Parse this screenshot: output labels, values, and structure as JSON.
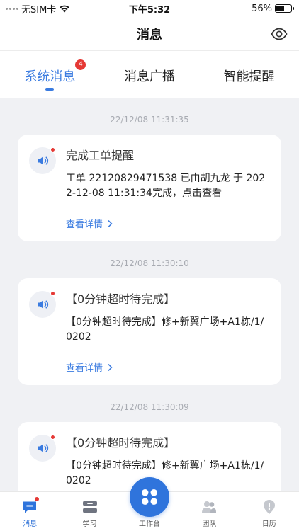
{
  "status_bar": {
    "carrier": "无SIM卡",
    "time": "下午5:32",
    "battery_percent": "56%",
    "battery_level": 0.56
  },
  "header": {
    "title": "消息",
    "eye_icon": "eye-icon"
  },
  "tabs": [
    {
      "label": "系统消息",
      "active": true,
      "badge": "4"
    },
    {
      "label": "消息广播",
      "active": false
    },
    {
      "label": "智能提醒",
      "active": false
    }
  ],
  "messages": [
    {
      "timestamp": "22/12/08 11:31:35",
      "title": "完成工单提醒",
      "text": "工单 22120829471538 已由胡九龙 于 2022-12-08 11:31:34完成，点击查看",
      "link": "查看详情"
    },
    {
      "timestamp": "22/12/08 11:30:10",
      "title": "【0分钟超时待完成】",
      "text": "【0分钟超时待完成】修+新翼广场+A1栋/1/0202",
      "link": "查看详情"
    },
    {
      "timestamp": "22/12/08 11:30:09",
      "title": "【0分钟超时待完成】",
      "text": "【0分钟超时待完成】修+新翼广场+A1栋/1/0202",
      "link": ""
    }
  ],
  "bottom_nav": [
    {
      "label": "消息",
      "icon": "message-icon",
      "active": true
    },
    {
      "label": "学习",
      "icon": "book-icon",
      "active": false
    },
    {
      "label": "工作台",
      "icon": "grid-icon",
      "active": false
    },
    {
      "label": "团队",
      "icon": "team-icon",
      "active": false
    },
    {
      "label": "日历",
      "icon": "calendar-icon",
      "active": false
    }
  ],
  "colors": {
    "accent": "#3a7be0",
    "badge": "#e53935",
    "background": "#f0f1f4"
  }
}
